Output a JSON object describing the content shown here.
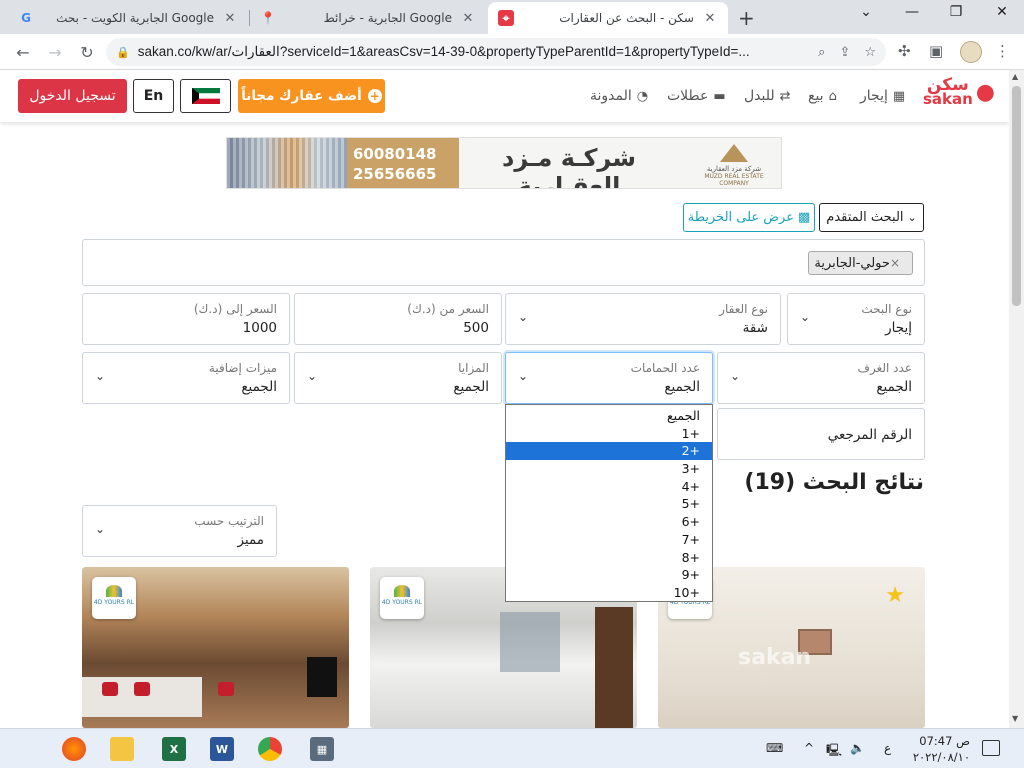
{
  "browser": {
    "tabs": [
      {
        "title": "الجابرية الكويت - بحث Google",
        "favicon": "G",
        "active": false
      },
      {
        "title": "الجابرية - خرائط Google",
        "favicon": "map-pin",
        "active": false
      },
      {
        "title": "سكن - البحث عن العقارات",
        "favicon": "sakan-pin",
        "active": true
      }
    ],
    "new_tab": "+",
    "url": "sakan.co/kw/ar/العقارات?serviceId=1&areasCsv=14-39-0&propertyTypeParentId=1&propertyTypeId=..."
  },
  "header": {
    "logo_ar": "سكن",
    "logo_en": "sakan",
    "nav": [
      "إيجار",
      "بيع",
      "للبدل",
      "عطلات",
      "المدونة"
    ],
    "add_property": "أضف عقارك مجاناً",
    "lang": "En",
    "login": "تسجيل الدخول",
    "brand_color": "#e63946"
  },
  "banner": {
    "phone1": "60080148",
    "phone2": "25656665",
    "company": "شركـة مـزد العقـارية",
    "logo_caption": "شركة مزد العقارية",
    "logo_caption_en": "MUZD REAL ESTATE COMPANY"
  },
  "search": {
    "advanced": "البحث المتقدم",
    "map": "عرض على الخريطة",
    "area_chip": "حولي-الجابرية",
    "chip_remove": "×",
    "search_type": {
      "label": "نوع البحث",
      "value": "إيجار"
    },
    "property_type": {
      "label": "نوع العقار",
      "value": "شقة"
    },
    "price_from": {
      "label": "السعر من (د.ك)",
      "value": "500"
    },
    "price_to": {
      "label": "السعر إلى (د.ك)",
      "value": "1000"
    },
    "rooms": {
      "label": "عدد الغرف",
      "value": "الجميع"
    },
    "bathrooms": {
      "label": "عدد الحمامات",
      "value": "الجميع"
    },
    "features": {
      "label": "المزايا",
      "value": "الجميع"
    },
    "extra_features": {
      "label": "ميزات إضافية",
      "value": "الجميع"
    },
    "ref_number": "الرقم المرجعي",
    "bathroom_options": [
      "الجميع",
      "1+",
      "2+",
      "3+",
      "4+",
      "5+",
      "6+",
      "7+",
      "8+",
      "9+",
      "10+"
    ],
    "bathroom_highlighted": "2+"
  },
  "results": {
    "title": "نتائج البحث (19)",
    "sort": {
      "label": "الترتيب حسب",
      "value": "مميز"
    },
    "badge_text": "4D YOURS RL",
    "watermark": "sakan"
  },
  "taskbar": {
    "time": "07:47 ص",
    "date": "٢٠٢٢/٠٨/١٠",
    "lang": "ع"
  }
}
